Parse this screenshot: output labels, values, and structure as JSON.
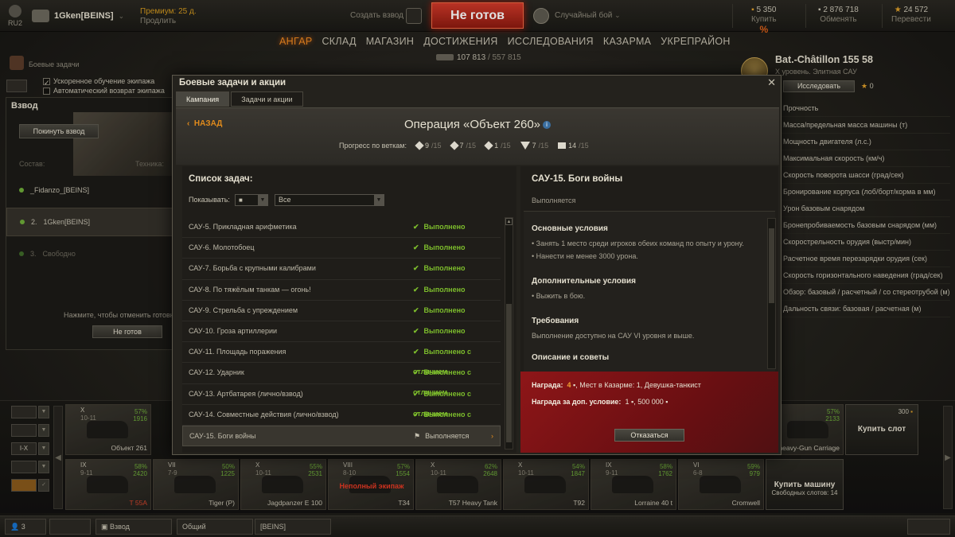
{
  "topbar": {
    "region": "RU2",
    "player": "1Gken[BEINS]",
    "premium_title": "Премиум: 25 д.",
    "premium_action": "Продлить",
    "create_platoon": "Создать взвод",
    "not_ready": "Не готов",
    "battle_mode": "Случайный бой",
    "gold_value": "5 350",
    "gold_label": "Купить",
    "gold_discount": "%",
    "credits_value": "2 876 718",
    "credits_label": "Обменять",
    "free_xp_value": "24 572",
    "free_xp_label": "Перевести"
  },
  "nav": {
    "items": [
      "АНГАР",
      "СКЛАД",
      "МАГАЗИН",
      "ДОСТИЖЕНИЯ",
      "ИССЛЕДОВАНИЯ",
      "КАЗАРМА",
      "УКРЕПРАЙОН"
    ],
    "active_index": 0,
    "xp_current": "107 813",
    "xp_total": "/ 557 815"
  },
  "left": {
    "missions_label": "Боевые задачи",
    "opt_accel": "Ускоренное обучение экипажа",
    "opt_return": "Автоматический возврат экипажа",
    "platoon_title": "Взвод",
    "leave_btn": "Покинуть взвод",
    "roster_label": "Состав:",
    "tech_label": "Техника:",
    "members": [
      "_Fidanzo_[BEINS]",
      "1Gken[BEINS]",
      "Свободно"
    ],
    "member_nums": [
      "",
      "2.",
      "3."
    ],
    "hint": "Нажмите, чтобы отменить готовн",
    "not_ready_btn": "Не готов"
  },
  "tank": {
    "name": "Bat.-Châtillon 155 58",
    "subtitle": "X уровень. Элитная САУ",
    "research_btn": "Исследовать",
    "xp": "0",
    "specs": [
      "Прочность",
      "Масса/предельная масса машины (т)",
      "Мощность двигателя (л.с.)",
      "Максимальная скорость (км/ч)",
      "Скорость поворота шасси (град/сек)",
      "Бронирование корпуса (лоб/борт/корма в мм)",
      "Урон базовым снарядом",
      "Бронепробиваемость базовым снарядом (мм)",
      "Скорострельность орудия (выстр/мин)",
      "Расчетное время перезарядки орудия (сек)",
      "Скорость горизонтального наведения (град/сек)",
      "Обзор: базовый / расчетный / со стереотрубой (м)",
      "Дальность связи: базовая / расчетная (м)"
    ]
  },
  "carousel": {
    "row1": [
      {
        "tier": "X",
        "lvl": "10-11",
        "pc": "57%",
        "pc2": "1916",
        "name": "Объект 261"
      },
      {
        "tier": "",
        "lvl": "",
        "pc": "57%",
        "pc2": "2133",
        "name": "heavy-Gun Carriage"
      }
    ],
    "row2": [
      {
        "tier": "IX",
        "lvl": "9-11",
        "pc": "58%",
        "pc2": "2420",
        "name": "T 55A",
        "red": true
      },
      {
        "tier": "VII",
        "lvl": "7-9",
        "pc": "50%",
        "pc2": "1225",
        "name": "Tiger (P)"
      },
      {
        "tier": "X",
        "lvl": "10-11",
        "pc": "55%",
        "pc2": "2531",
        "name": "Jagdpanzer E 100"
      },
      {
        "tier": "VIII",
        "lvl": "8-10",
        "pc": "57%",
        "pc2": "1554",
        "name": "T34",
        "crew": "Неполный экипаж"
      },
      {
        "tier": "X",
        "lvl": "10-11",
        "pc": "62%",
        "pc2": "2648",
        "name": "T57 Heavy Tank"
      },
      {
        "tier": "X",
        "lvl": "10-11",
        "pc": "54%",
        "pc2": "1847",
        "name": "T92"
      },
      {
        "tier": "IX",
        "lvl": "9-11",
        "pc": "58%",
        "pc2": "1762",
        "name": "Lorraine 40 t"
      },
      {
        "tier": "VI",
        "lvl": "6-8",
        "pc": "59%",
        "pc2": "979",
        "name": "Cromwell"
      }
    ],
    "buy_slot": "Купить слот",
    "buy_slot_price": "300",
    "buy_vehicle": "Купить машину",
    "free_slots": "Свободных слотов: 14",
    "filter_level": "I-X"
  },
  "bottom": {
    "online": "3",
    "platoon": "Взвод",
    "channel_general": "Общий",
    "channel_clan": "[BEINS]"
  },
  "modal": {
    "title": "Боевые задачи и акции",
    "tabs": [
      "Кампания",
      "Задачи и акции"
    ],
    "back": "НАЗАД",
    "operation": "Операция «Объект 260»",
    "info": "i",
    "progress_label": "Прогресс по веткам:",
    "branches": [
      {
        "done": "9",
        "of": "/15"
      },
      {
        "done": "7",
        "of": "/15"
      },
      {
        "done": "1",
        "of": "/15"
      },
      {
        "done": "7",
        "of": "/15"
      },
      {
        "done": "14",
        "of": "/15"
      }
    ],
    "list_title": "Список задач:",
    "show_label": "Показывать:",
    "filter_all": "Все",
    "tasks": [
      {
        "name": "САУ-5. Прикладная арифметика",
        "status": "Выполнено"
      },
      {
        "name": "САУ-6. Молотобоец",
        "status": "Выполнено"
      },
      {
        "name": "САУ-7. Борьба с крупными калибрами",
        "status": "Выполнено"
      },
      {
        "name": "САУ-8. По тяжёлым танкам — огонь!",
        "status": "Выполнено"
      },
      {
        "name": "САУ-9. Стрельба с упреждением",
        "status": "Выполнено"
      },
      {
        "name": "САУ-10. Гроза артиллерии",
        "status": "Выполнено"
      },
      {
        "name": "САУ-11. Площадь поражения",
        "status": "Выполнено с отличием"
      },
      {
        "name": "САУ-12. Ударник",
        "status": "Выполнено с отличием"
      },
      {
        "name": "САУ-13. Артбатарея (лично/взвод)",
        "status": "Выполнено с отличием"
      },
      {
        "name": "САУ-14. Совместные действия (лично/взвод)",
        "status": "Выполнено с отличием"
      },
      {
        "name": "САУ-15. Боги войны",
        "status": "Выполняется"
      }
    ],
    "detail": {
      "title": "САУ-15. Боги войны",
      "status": "Выполняется",
      "main_cond_title": "Основные условия",
      "main_cond": [
        "• Занять 1 место среди игроков обеих команд по опыту и урону.",
        "• Нанести не менее 3000 урона."
      ],
      "extra_cond_title": "Дополнительные условия",
      "extra_cond": [
        "• Выжить в бою."
      ],
      "req_title": "Требования",
      "req": "Выполнение доступно на САУ VI уровня и выше.",
      "cut_title": "Описание и советы",
      "reward_label": "Награда:",
      "reward_num": "4",
      "reward_text": ", Мест в Казарме: 1, Девушка-танкист",
      "extra_reward_label": "Награда за доп. условие:",
      "extra_reward_num": "1",
      "extra_reward_text": ", 500 000",
      "decline": "Отказаться"
    }
  },
  "colors": {
    "accent": "#f08a21",
    "done": "#7dbd2c",
    "reward_bg": "#8e1618",
    "not_ready": "#c0281a"
  }
}
